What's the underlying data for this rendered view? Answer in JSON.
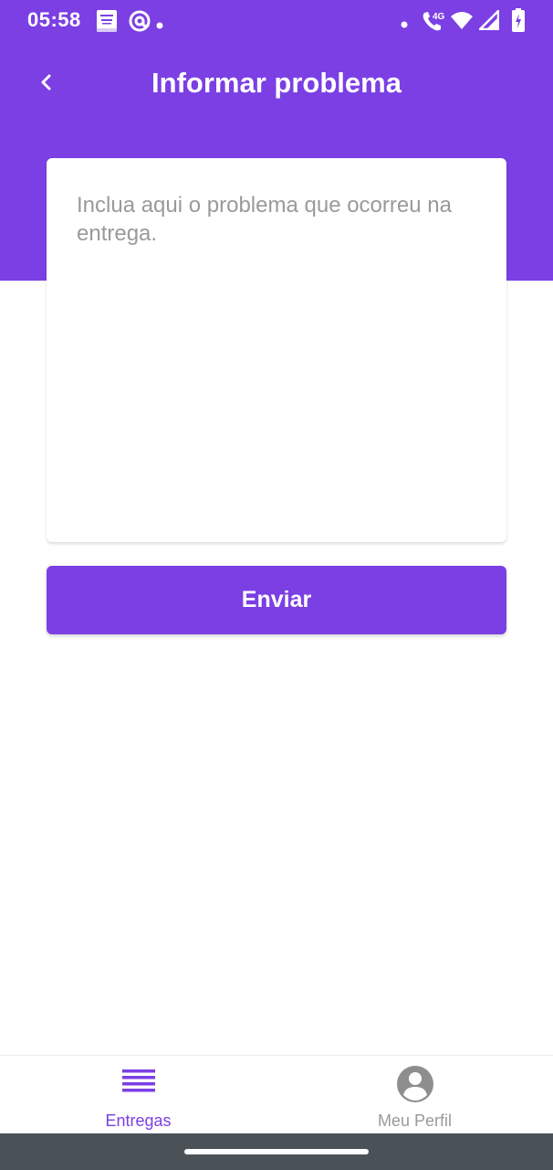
{
  "status_bar": {
    "time": "05:58",
    "network_label": "4G",
    "icons": [
      "bible-app-icon",
      "at-sign-icon",
      "notification-dot-icon",
      "dot-icon",
      "wifi-call-icon",
      "wifi-icon",
      "signal-icon",
      "battery-charging-icon"
    ]
  },
  "app_bar": {
    "title": "Informar problema",
    "back_icon": "chevron-left-icon"
  },
  "problem_form": {
    "placeholder": "Inclua aqui o problema que ocorreu na entrega.",
    "value": ""
  },
  "send_button": {
    "label": "Enviar"
  },
  "bottom_nav": {
    "items": [
      {
        "label": "Entregas",
        "icon": "list-icon",
        "active": true
      },
      {
        "label": "Meu Perfil",
        "icon": "account-circle-icon",
        "active": false
      }
    ]
  },
  "colors": {
    "primary": "#7b3fe4",
    "inactive": "#9a9a9a",
    "system_nav": "#4a5157"
  }
}
